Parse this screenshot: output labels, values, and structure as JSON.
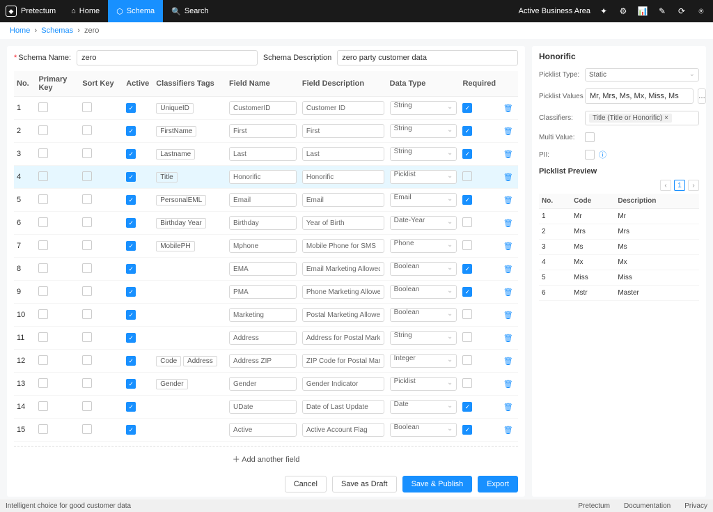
{
  "brand": "Pretectum",
  "nav": {
    "home": "Home",
    "schema": "Schema",
    "search": "Search"
  },
  "businessArea": "Active Business Area",
  "breadcrumb": {
    "home": "Home",
    "schemas": "Schemas",
    "current": "zero"
  },
  "schemaName": {
    "label": "Schema Name:",
    "value": "zero"
  },
  "schemaDesc": {
    "label": "Schema Description",
    "value": "zero party customer data"
  },
  "cols": {
    "no": "No.",
    "pk": "Primary Key",
    "sk": "Sort Key",
    "active": "Active",
    "tags": "Classifiers Tags",
    "name": "Field Name",
    "desc": "Field Description",
    "type": "Data Type",
    "req": "Required"
  },
  "rows": [
    {
      "no": "1",
      "active": true,
      "tags": [
        "UniqueID"
      ],
      "name": "CustomerID",
      "desc": "Customer ID",
      "type": "String",
      "req": true
    },
    {
      "no": "2",
      "active": true,
      "tags": [
        "FirstName"
      ],
      "name": "First",
      "desc": "First",
      "type": "String",
      "req": true
    },
    {
      "no": "3",
      "active": true,
      "tags": [
        "Lastname"
      ],
      "name": "Last",
      "desc": "Last",
      "type": "String",
      "req": true
    },
    {
      "no": "4",
      "active": true,
      "tags": [
        "Title"
      ],
      "name": "Honorific",
      "desc": "Honorific",
      "type": "Picklist",
      "req": false,
      "selected": true
    },
    {
      "no": "5",
      "active": true,
      "tags": [
        "PersonalEML"
      ],
      "name": "Email",
      "desc": "Email",
      "type": "Email",
      "req": true
    },
    {
      "no": "6",
      "active": true,
      "tags": [
        "Birthday Year"
      ],
      "name": "Birthday",
      "desc": "Year of Birth",
      "type": "Date-Year",
      "req": false
    },
    {
      "no": "7",
      "active": true,
      "tags": [
        "MobilePH"
      ],
      "name": "Mphone",
      "desc": "Mobile Phone for SMS",
      "type": "Phone",
      "req": false
    },
    {
      "no": "8",
      "active": true,
      "tags": [],
      "name": "EMA",
      "desc": "Email Marketing Allowed",
      "type": "Boolean",
      "req": true
    },
    {
      "no": "9",
      "active": true,
      "tags": [],
      "name": "PMA",
      "desc": "Phone Marketing Allowed",
      "type": "Boolean",
      "req": true
    },
    {
      "no": "10",
      "active": true,
      "tags": [],
      "name": "Marketing",
      "desc": "Postal Marketing Allowed",
      "type": "Boolean",
      "req": false
    },
    {
      "no": "11",
      "active": true,
      "tags": [],
      "name": "Address",
      "desc": "Address for Postal Marketing",
      "type": "String",
      "req": false
    },
    {
      "no": "12",
      "active": true,
      "tags": [
        "Code",
        "Address"
      ],
      "name": "Address ZIP",
      "desc": "ZIP Code for Postal Marketing",
      "type": "Integer",
      "req": false
    },
    {
      "no": "13",
      "active": true,
      "tags": [
        "Gender"
      ],
      "name": "Gender",
      "desc": "Gender Indicator",
      "type": "Picklist",
      "req": false
    },
    {
      "no": "14",
      "active": true,
      "tags": [],
      "name": "UDate",
      "desc": "Date of Last Update",
      "type": "Date",
      "req": true
    },
    {
      "no": "15",
      "active": true,
      "tags": [],
      "name": "Active",
      "desc": "Active Account Flag",
      "type": "Boolean",
      "req": true
    }
  ],
  "addField": "Add another field",
  "buttons": {
    "cancel": "Cancel",
    "draft": "Save as Draft",
    "publish": "Save & Publish",
    "export": "Export"
  },
  "side": {
    "title": "Honorific",
    "picklistTypeLbl": "Picklist Type:",
    "picklistType": "Static",
    "picklistValuesLbl": "Picklist Values",
    "picklistValues": "Mr, Mrs, Ms, Mx, Miss, Ms",
    "classifiersLbl": "Classifiers:",
    "classifierChip": "Title (Title or Honorific) ×",
    "multiValueLbl": "Multi Value:",
    "piiLbl": "PII:",
    "previewTitle": "Picklist Preview",
    "page": "1",
    "previewCols": {
      "no": "No.",
      "code": "Code",
      "desc": "Description"
    },
    "preview": [
      {
        "no": "1",
        "code": "Mr",
        "desc": "Mr"
      },
      {
        "no": "2",
        "code": "Mrs",
        "desc": "Mrs"
      },
      {
        "no": "3",
        "code": "Ms",
        "desc": "Ms"
      },
      {
        "no": "4",
        "code": "Mx",
        "desc": "Mx"
      },
      {
        "no": "5",
        "code": "Miss",
        "desc": "Miss"
      },
      {
        "no": "6",
        "code": "Mstr",
        "desc": "Master"
      }
    ]
  },
  "footer": {
    "tagline": "Intelligent choice for good customer data",
    "brand": "Pretectum",
    "docs": "Documentation",
    "privacy": "Privacy"
  }
}
